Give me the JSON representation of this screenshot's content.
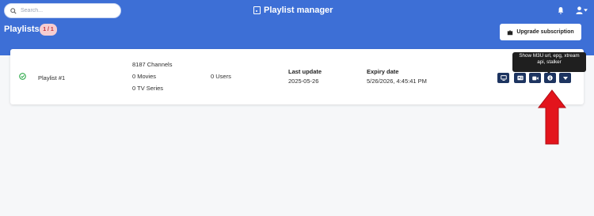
{
  "header": {
    "search_placeholder": "Search...",
    "title": "Playlist manager"
  },
  "playlists": {
    "title": "Playlists",
    "count_badge": "1 / 1",
    "upgrade_label": "Upgrade subscription"
  },
  "row": {
    "name": "Playlist #1",
    "channels": "8187 Channels",
    "movies": "0 Movies",
    "series": "0 TV Series",
    "users": "0 Users",
    "last_update_label": "Last update",
    "last_update_value": "2025-05-26",
    "expiry_label": "Expiry date",
    "expiry_value": "5/26/2026, 4:45:41 PM",
    "status_icon": "check-circle-icon",
    "actions": [
      "tv-icon",
      "id-card-icon",
      "video-camera-icon",
      "info-icon",
      "chevron-down-icon"
    ]
  },
  "tooltip": {
    "text": "Show M3U url, epg, xtream api, stalker"
  },
  "colors": {
    "header": "#3d6fd6",
    "action_button": "#1d3460",
    "badge_bg": "#f6cdd0",
    "badge_text": "#c1323c",
    "annotation_arrow": "#e3141c"
  }
}
